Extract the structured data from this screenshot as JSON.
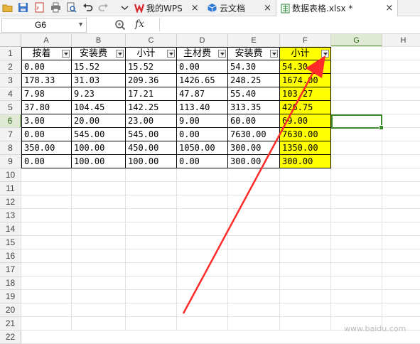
{
  "tabs": {
    "wps_home": "我的WPS",
    "cloud_docs": "云文档",
    "sheet_file": "数据表格.xlsx *",
    "close_glyph": "×"
  },
  "formula_bar": {
    "cell_ref": "G6",
    "fx_label": "fx",
    "content": ""
  },
  "sheet": {
    "columns": [
      "A",
      "B",
      "C",
      "D",
      "E",
      "F",
      "G",
      "H"
    ],
    "rows": [
      "1",
      "2",
      "3",
      "4",
      "5",
      "6",
      "7",
      "8",
      "9",
      "10",
      "11",
      "12",
      "13",
      "14",
      "15",
      "16",
      "17",
      "18",
      "19",
      "20",
      "21",
      "22"
    ],
    "selected_column": "G",
    "selected_row": "6",
    "header_row": [
      "按着",
      "安装费",
      "小计",
      "主材费",
      "安装费",
      "小计"
    ],
    "data": [
      [
        "0.00",
        "15.52",
        "15.52",
        "0.00",
        "54.30",
        "54.30"
      ],
      [
        "178.33",
        "31.03",
        "209.36",
        "1426.65",
        "248.25",
        "1674.00"
      ],
      [
        "7.98",
        "9.23",
        "17.21",
        "47.87",
        "55.40",
        "103.27"
      ],
      [
        "37.80",
        "104.45",
        "142.25",
        "113.40",
        "313.35",
        "426.75"
      ],
      [
        "3.00",
        "20.00",
        "23.00",
        "9.00",
        "60.00",
        "69.00"
      ],
      [
        "0.00",
        "545.00",
        "545.00",
        "0.00",
        "7630.00",
        "7630.00"
      ],
      [
        "350.00",
        "100.00",
        "450.00",
        "1050.00",
        "300.00",
        "1350.00"
      ],
      [
        "0.00",
        "100.00",
        "100.00",
        "0.00",
        "300.00",
        "300.00"
      ]
    ],
    "highlight_color": "#ffff00",
    "active_border_color": "#3c8a2e"
  },
  "annotation": {
    "arrow_color": "#ff2a2a"
  },
  "watermark": "www.baidu.com"
}
